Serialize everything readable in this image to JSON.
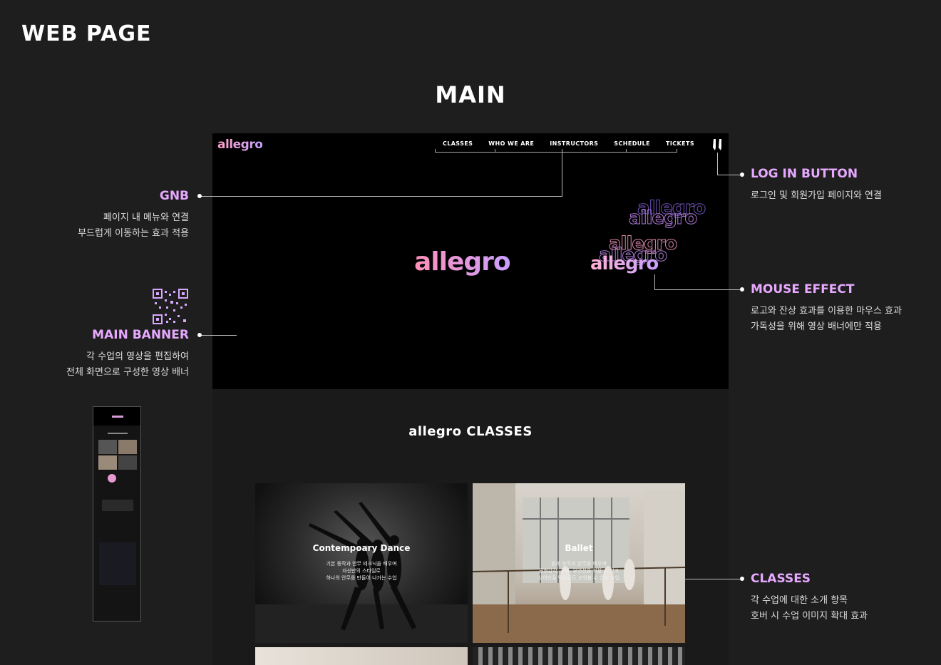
{
  "page_title": "WEB PAGE",
  "section_title": "MAIN",
  "site": {
    "logo": "allegro",
    "nav": [
      "CLASSES",
      "WHO WE ARE",
      "INSTRUCTORS",
      "SCHEDULE",
      "TICKETS"
    ],
    "hero_logo": "allegro",
    "ghost_text": "allegro",
    "classes_title": "allegro CLASSES",
    "cards": [
      {
        "title": "Contempoary Dance",
        "desc": [
          "기본 동작과 안무 테크닉을 배우며",
          "자신만의 스타일로",
          "하나의 안무를 만들어 나가는 수업"
        ]
      },
      {
        "title": "Ballet",
        "desc": [
          "발레 동작과 안무를 배우며",
          "균형감각, 근력, 유연성을 키울 수 있고",
          "상하반을 탁수도도 꼬워볼 수 있는 수업"
        ]
      }
    ]
  },
  "annotations": {
    "gnb": {
      "title": "GNB",
      "desc": [
        "페이지 내 메뉴와 연결",
        "부드럽게 이동하는 효과 적용"
      ]
    },
    "main_banner": {
      "title": "MAIN BANNER",
      "desc": [
        "각 수업의 영상을 편집하여",
        "전체 화면으로 구성한 영상 배너"
      ]
    },
    "login": {
      "title": "LOG IN BUTTON",
      "desc": [
        "로그인 및 회원가입 페이지와 연결"
      ]
    },
    "mouse": {
      "title": "MOUSE EFFECT",
      "desc": [
        "로고와 잔상 효과를 이용한 마우스 효과",
        "가독성을 위해 영상 배너에만 적용"
      ]
    },
    "classes": {
      "title": "CLASSES",
      "desc": [
        "각 수업에 대한 소개 항목",
        "호버 시 수업 이미지 확대 효과"
      ]
    }
  },
  "colors": {
    "accent": "#e7a9ff",
    "logo_start": "#ff8fb8",
    "logo_end": "#c8a0ff",
    "background": "#1e1e1e"
  }
}
